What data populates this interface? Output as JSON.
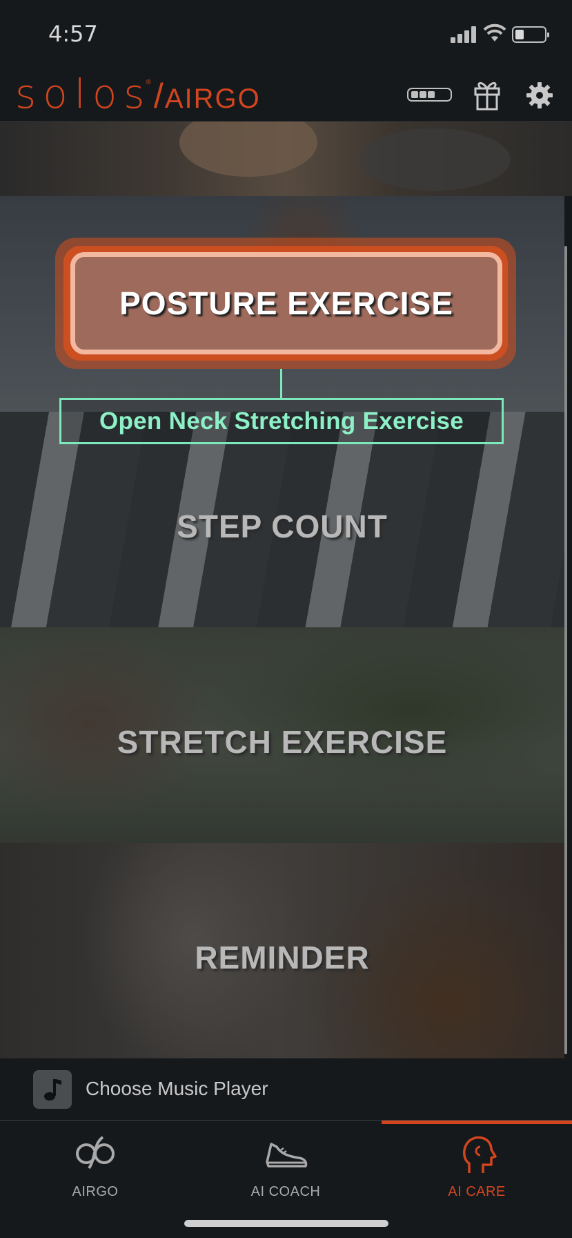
{
  "status_bar": {
    "time": "4:57"
  },
  "header": {
    "logo_brand": "solos",
    "logo_registered": "®",
    "logo_separator": "/",
    "logo_product": "AIRGO",
    "icons": [
      "battery-icon",
      "gift-icon",
      "gear-icon"
    ]
  },
  "cards": {
    "posture": "POSTURE EXERCISE",
    "step": "STEP COUNT",
    "stretch": "STRETCH EXERCISE",
    "reminder": "REMINDER"
  },
  "annotation": {
    "label": "Open Neck Stretching Exercise",
    "color": "#7ee8bd"
  },
  "music_bar": {
    "label": "Choose Music Player",
    "icon": "music-note-icon"
  },
  "tab_bar": {
    "active": "AI CARE",
    "tabs": [
      {
        "label": "AIRGO",
        "icon": "airgo-logo-icon"
      },
      {
        "label": "AI COACH",
        "icon": "sneaker-icon"
      },
      {
        "label": "AI CARE",
        "icon": "head-profile-icon"
      }
    ]
  },
  "colors": {
    "accent": "#d2451e",
    "background": "#16191c",
    "annotation": "#7ee8bd"
  }
}
